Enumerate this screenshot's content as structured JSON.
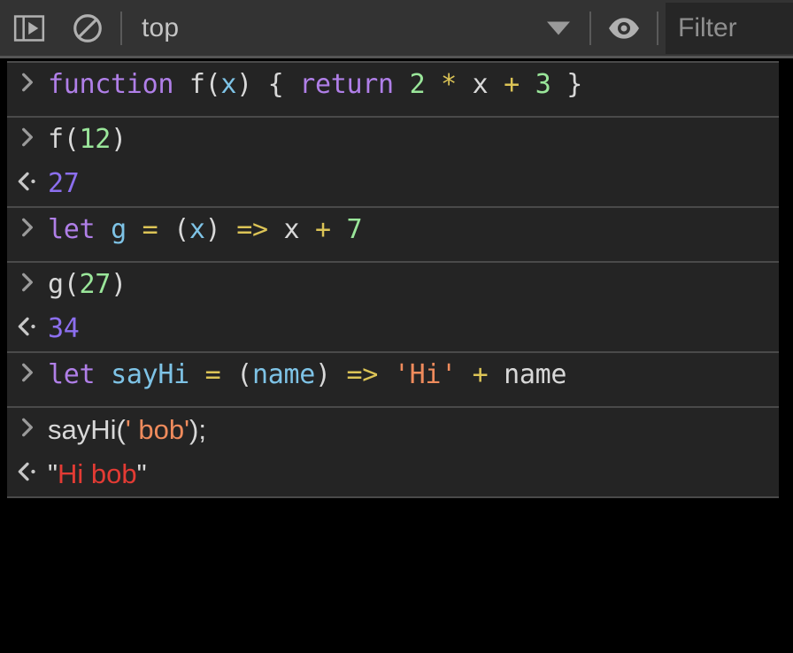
{
  "toolbar": {
    "buttons": [
      {
        "name": "toggle-console-sidebar-button",
        "icon": "sidebar-play-icon",
        "title": "Show console sidebar"
      },
      {
        "name": "clear-console-button",
        "icon": "ban-circle-icon",
        "title": "Clear console"
      },
      {
        "name": "console-settings-eye-button",
        "icon": "eye-icon",
        "title": "Live expression / eye"
      }
    ],
    "context": {
      "label": "top",
      "arrow_icon": "chevron-down-icon"
    },
    "filter": {
      "placeholder": "Filter",
      "value": ""
    }
  },
  "colors": {
    "toolbar_bg": "#333333",
    "console_bg": "#242424",
    "divider": "#4a4a4a",
    "page_bg": "#000000",
    "keyword": "#b07fe8",
    "variable": "#7ec3e6",
    "number": "#9ae69a",
    "operator": "#dcc456",
    "string": "#ef8b5c",
    "plain": "#d8d8d8",
    "result_number": "#8c6fef",
    "result_string": "#e33b34"
  },
  "console": {
    "prompt_icon": "chevron-right-icon",
    "result_icon": "chevron-left-dot-icon",
    "groups": [
      {
        "name": "group-function-declaration",
        "lines": [
          {
            "kind": "input",
            "font": "mono",
            "text": "function f(x) { return 2 * x + 3 }",
            "tokens": [
              {
                "t": "function",
                "c": "t-kw"
              },
              {
                "t": " ",
                "c": "t-plain"
              },
              {
                "t": "f",
                "c": "t-plain"
              },
              {
                "t": "(",
                "c": "t-plain"
              },
              {
                "t": "x",
                "c": "t-var"
              },
              {
                "t": ")",
                "c": "t-plain"
              },
              {
                "t": " { ",
                "c": "t-plain"
              },
              {
                "t": "return",
                "c": "t-kw"
              },
              {
                "t": " ",
                "c": "t-plain"
              },
              {
                "t": "2",
                "c": "t-num"
              },
              {
                "t": " ",
                "c": "t-plain"
              },
              {
                "t": "*",
                "c": "t-op"
              },
              {
                "t": " x ",
                "c": "t-plain"
              },
              {
                "t": "+",
                "c": "t-op"
              },
              {
                "t": " ",
                "c": "t-plain"
              },
              {
                "t": "3",
                "c": "t-num"
              },
              {
                "t": " }",
                "c": "t-plain"
              }
            ]
          }
        ]
      },
      {
        "name": "group-f12",
        "lines": [
          {
            "kind": "input",
            "font": "mono",
            "text": "f(12)",
            "tokens": [
              {
                "t": "f(",
                "c": "t-plain"
              },
              {
                "t": "12",
                "c": "t-num"
              },
              {
                "t": ")",
                "c": "t-plain"
              }
            ]
          },
          {
            "kind": "output",
            "font": "mono",
            "text": "27",
            "tokens": [
              {
                "t": "27",
                "c": "t-res"
              }
            ]
          }
        ]
      },
      {
        "name": "group-let-g",
        "lines": [
          {
            "kind": "input",
            "font": "mono",
            "text": "let g = (x) => x + 7",
            "tokens": [
              {
                "t": "let",
                "c": "t-kw"
              },
              {
                "t": " ",
                "c": "t-plain"
              },
              {
                "t": "g",
                "c": "t-var"
              },
              {
                "t": " ",
                "c": "t-plain"
              },
              {
                "t": "=",
                "c": "t-op"
              },
              {
                "t": " (",
                "c": "t-plain"
              },
              {
                "t": "x",
                "c": "t-var"
              },
              {
                "t": ") ",
                "c": "t-plain"
              },
              {
                "t": "=>",
                "c": "t-op"
              },
              {
                "t": " x ",
                "c": "t-plain"
              },
              {
                "t": "+",
                "c": "t-op"
              },
              {
                "t": " ",
                "c": "t-plain"
              },
              {
                "t": "7",
                "c": "t-num"
              }
            ]
          }
        ]
      },
      {
        "name": "group-g27",
        "lines": [
          {
            "kind": "input",
            "font": "mono",
            "text": "g(27)",
            "tokens": [
              {
                "t": "g(",
                "c": "t-plain"
              },
              {
                "t": "27",
                "c": "t-num"
              },
              {
                "t": ")",
                "c": "t-plain"
              }
            ]
          },
          {
            "kind": "output",
            "font": "mono",
            "text": "34",
            "tokens": [
              {
                "t": "34",
                "c": "t-res"
              }
            ]
          }
        ]
      },
      {
        "name": "group-let-sayhi",
        "lines": [
          {
            "kind": "input",
            "font": "mono",
            "text": "let sayHi = (name) => 'Hi' + name",
            "tokens": [
              {
                "t": "let",
                "c": "t-kw"
              },
              {
                "t": " ",
                "c": "t-plain"
              },
              {
                "t": "sayHi",
                "c": "t-var"
              },
              {
                "t": " ",
                "c": "t-plain"
              },
              {
                "t": "=",
                "c": "t-op"
              },
              {
                "t": " (",
                "c": "t-plain"
              },
              {
                "t": "name",
                "c": "t-var"
              },
              {
                "t": ") ",
                "c": "t-plain"
              },
              {
                "t": "=>",
                "c": "t-op"
              },
              {
                "t": " ",
                "c": "t-plain"
              },
              {
                "t": "'Hi'",
                "c": "t-str"
              },
              {
                "t": " ",
                "c": "t-plain"
              },
              {
                "t": "+",
                "c": "t-op"
              },
              {
                "t": " name",
                "c": "t-plain"
              }
            ]
          }
        ]
      },
      {
        "name": "group-sayhi-call",
        "lines": [
          {
            "kind": "input",
            "font": "sans",
            "text": "sayHi(' bob');",
            "tokens": [
              {
                "t": "sayHi(",
                "c": "t-plain"
              },
              {
                "t": "' bob'",
                "c": "t-str"
              },
              {
                "t": ");",
                "c": "t-plain"
              }
            ]
          },
          {
            "kind": "output",
            "font": "sans",
            "text": "\"Hi bob\"",
            "tokens": [
              {
                "t": "\"",
                "c": "t-quote"
              },
              {
                "t": "Hi bob",
                "c": "t-resstr"
              },
              {
                "t": "\"",
                "c": "t-quote"
              }
            ]
          }
        ]
      }
    ]
  }
}
